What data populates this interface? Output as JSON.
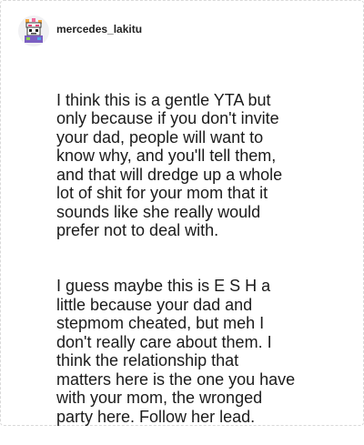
{
  "post": {
    "username": "mercedes_lakitu",
    "avatar_icon": "pixel-character-avatar-icon",
    "paragraphs": [
      "I think this is a gentle YTA but\nonly because if you don't invite\nyour dad, people will want to\nknow why, and you'll tell them,\nand that will dredge up a whole\nlot of shit for your mom that it\nsounds like she really would\nprefer not to deal with.",
      "I guess maybe this is E S H a\nlittle because your dad and\nstepmom cheated, but meh I\ndon't really care about them. I\nthink the relationship that\nmatters here is the one you have\nwith your mom, the wronged\nparty here. Follow her lead."
    ]
  }
}
